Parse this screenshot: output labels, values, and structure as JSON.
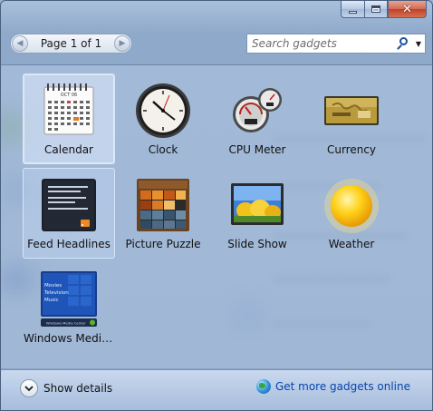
{
  "pager": {
    "text": "Page 1 of 1",
    "prev_glyph": "◀",
    "next_glyph": "▶"
  },
  "search": {
    "placeholder": "Search gadgets",
    "icon": "search-icon",
    "dropdown_glyph": "▼"
  },
  "window_controls": {
    "close_glyph": "✕"
  },
  "gadgets": [
    {
      "label": "Calendar",
      "icon": "calendar-icon",
      "selected": true,
      "month": "OCT 06"
    },
    {
      "label": "Clock",
      "icon": "clock-icon"
    },
    {
      "label": "CPU Meter",
      "icon": "cpu-meter-icon"
    },
    {
      "label": "Currency",
      "icon": "currency-icon"
    },
    {
      "label": "Feed Headlines",
      "icon": "feed-headlines-icon"
    },
    {
      "label": "Picture Puzzle",
      "icon": "picture-puzzle-icon"
    },
    {
      "label": "Slide Show",
      "icon": "slide-show-icon"
    },
    {
      "label": "Weather",
      "icon": "weather-icon"
    },
    {
      "label": "Windows Media...",
      "icon": "windows-media-center-icon",
      "menu_items": [
        "Movies",
        "Television",
        "Music"
      ],
      "bar_text": "Windows Media Center"
    }
  ],
  "footer": {
    "details_label": "Show details",
    "details_icon": "chevron-down-icon",
    "more_label": "Get more gadgets online",
    "more_icon": "globe-icon",
    "link_color": "#0645ad"
  }
}
